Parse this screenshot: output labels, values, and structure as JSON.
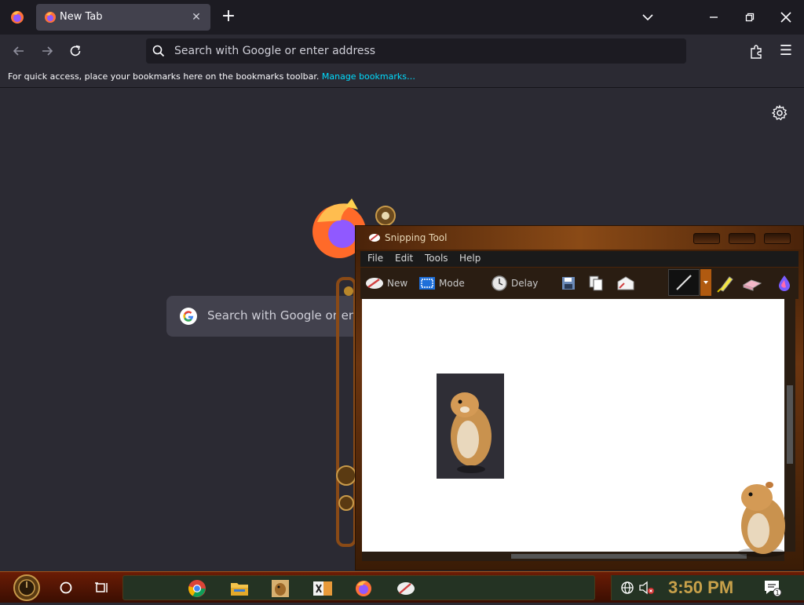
{
  "browser": {
    "tab": {
      "title": "New Tab",
      "close_glyph": "✕"
    },
    "new_tab_glyph": "+",
    "address_bar": {
      "placeholder": "Search with Google or enter address"
    },
    "menu_glyph": "☰",
    "bookmarks_toolbar": {
      "message": "For quick access, place your bookmarks here on the bookmarks toolbar.",
      "link": "Manage bookmarks…"
    },
    "new_tab_page": {
      "search_placeholder": "Search with Google or enter",
      "logo_partial_text": "fox"
    }
  },
  "snipping_tool": {
    "title": "Snipping Tool",
    "menu": [
      "File",
      "Edit",
      "Tools",
      "Help"
    ],
    "toolbar": {
      "new_label": "New",
      "mode_label": "Mode",
      "delay_label": "Delay"
    }
  },
  "taskbar": {
    "clock": "3:50 PM",
    "notification_count": "1"
  },
  "colors": {
    "browser_bg": "#2b2a33",
    "tabbar_bg": "#1c1b22",
    "link": "#00ddff",
    "taskbar_clock": "#c8a14a"
  }
}
